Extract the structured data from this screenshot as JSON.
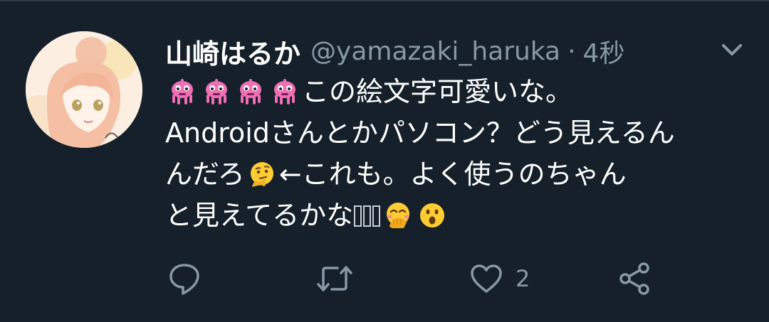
{
  "tweet": {
    "display_name": "山崎はるか",
    "handle": "@yamazaki_haruka",
    "separator": "·",
    "time": "4秒",
    "text": {
      "line1": "この絵文字可愛いな。",
      "line2": "Androidさんとかパソコン？どう見えるん",
      "line3_a": "んだろ",
      "line3_b": "←これも。よく使うのちゃん",
      "line4": "と見えてるかな"
    },
    "emojis": [
      "alien-monster-emoji",
      "alien-monster-emoji",
      "alien-monster-emoji",
      "alien-monster-emoji",
      "thinking-face-emoji",
      "hand-over-mouth-emoji",
      "hushed-face-emoji"
    ]
  },
  "actions": {
    "reply_icon": "reply-icon",
    "retweet_icon": "retweet-icon",
    "like_icon": "heart-icon",
    "like_count": "2",
    "share_icon": "share-icon"
  },
  "colors": {
    "background": "#15202b",
    "secondary_text": "#8899a6",
    "primary_text": "#ffffff",
    "alien_pink": "#f06eb4"
  }
}
